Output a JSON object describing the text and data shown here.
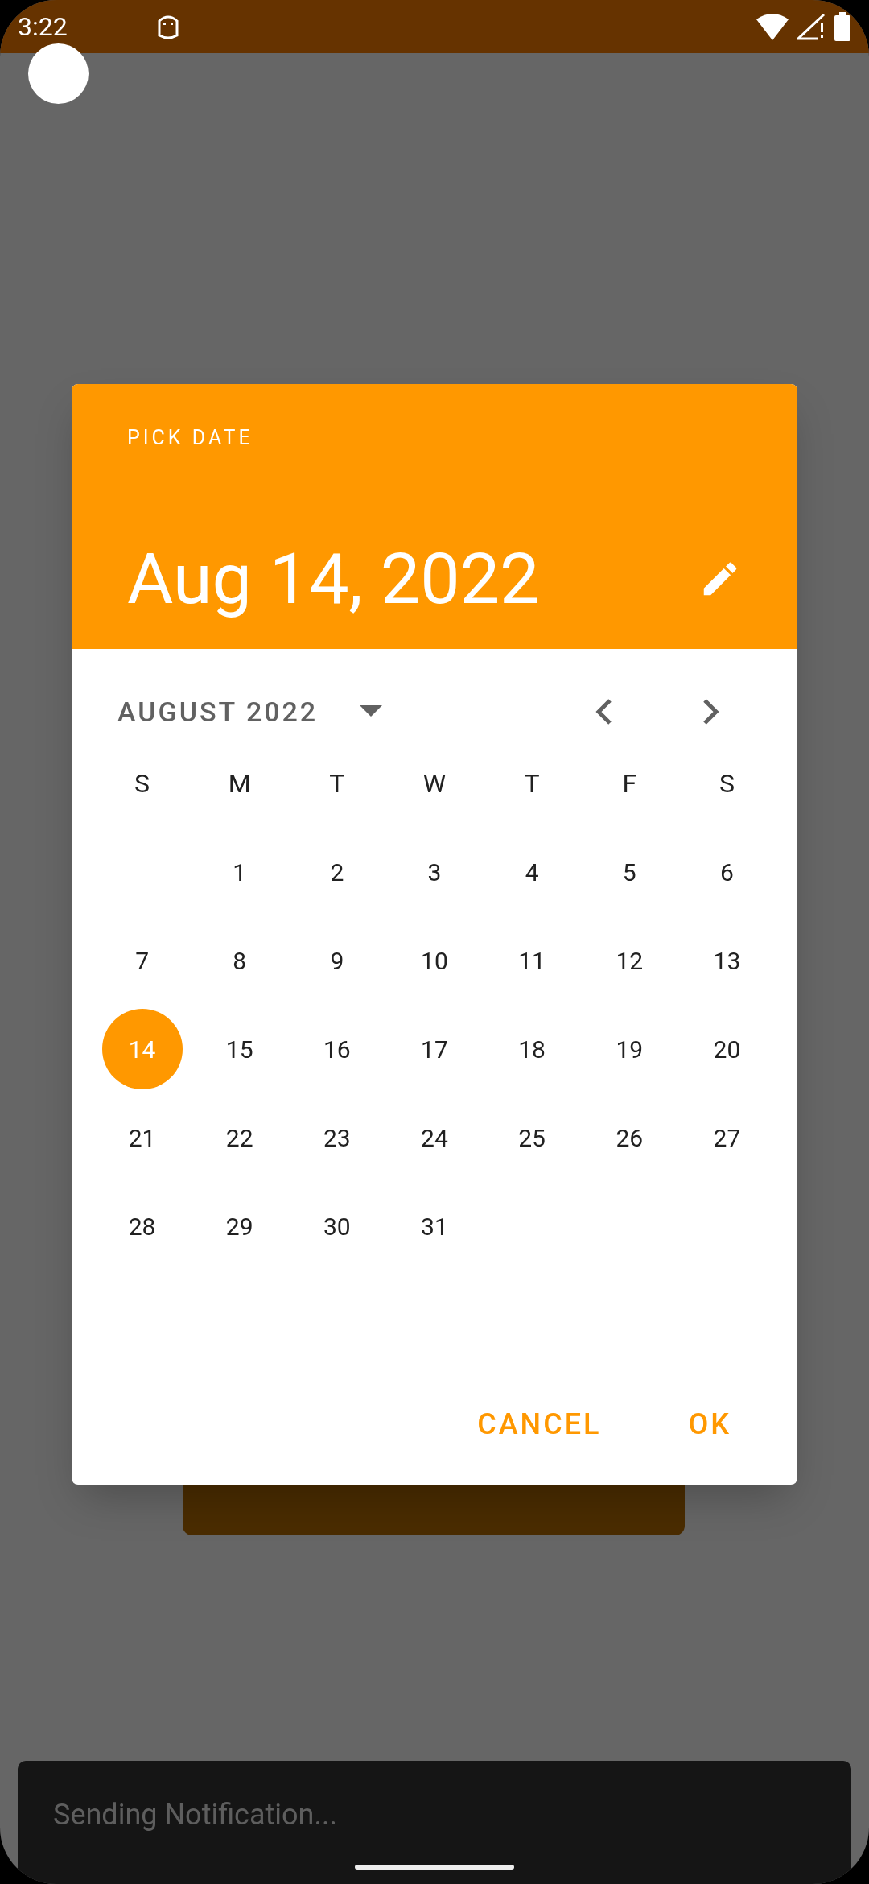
{
  "status_bar": {
    "time": "3:22"
  },
  "dialog": {
    "title": "PICK DATE",
    "selected_date": "Aug 14, 2022",
    "month_label": "AUGUST 2022",
    "weekdays": [
      "S",
      "M",
      "T",
      "W",
      "T",
      "F",
      "S"
    ],
    "weeks": [
      {
        "days": [
          {
            "label": "1",
            "selected": false
          },
          {
            "label": "2",
            "selected": false
          },
          {
            "label": "3",
            "selected": false
          },
          {
            "label": "4",
            "selected": false
          },
          {
            "label": "5",
            "selected": false
          },
          {
            "label": "6",
            "selected": false
          }
        ]
      },
      {
        "days": [
          {
            "label": "7",
            "selected": false
          },
          {
            "label": "8",
            "selected": false
          },
          {
            "label": "9",
            "selected": false
          },
          {
            "label": "10",
            "selected": false
          },
          {
            "label": "11",
            "selected": false
          },
          {
            "label": "12",
            "selected": false
          },
          {
            "label": "13",
            "selected": false
          }
        ]
      },
      {
        "days": [
          {
            "label": "14",
            "selected": true
          },
          {
            "label": "15",
            "selected": false
          },
          {
            "label": "16",
            "selected": false
          },
          {
            "label": "17",
            "selected": false
          },
          {
            "label": "18",
            "selected": false
          },
          {
            "label": "19",
            "selected": false
          },
          {
            "label": "20",
            "selected": false
          }
        ]
      },
      {
        "days": [
          {
            "label": "21",
            "selected": false
          },
          {
            "label": "22",
            "selected": false
          },
          {
            "label": "23",
            "selected": false
          },
          {
            "label": "24",
            "selected": false
          },
          {
            "label": "25",
            "selected": false
          },
          {
            "label": "26",
            "selected": false
          },
          {
            "label": "27",
            "selected": false
          }
        ]
      },
      {
        "days": [
          {
            "label": "28",
            "selected": false
          },
          {
            "label": "29",
            "selected": false
          },
          {
            "label": "30",
            "selected": false
          },
          {
            "label": "31",
            "selected": false
          }
        ]
      }
    ],
    "buttons": [
      "CANCEL",
      "OK"
    ]
  },
  "snackbar": {
    "text": "Sending Notification..."
  }
}
